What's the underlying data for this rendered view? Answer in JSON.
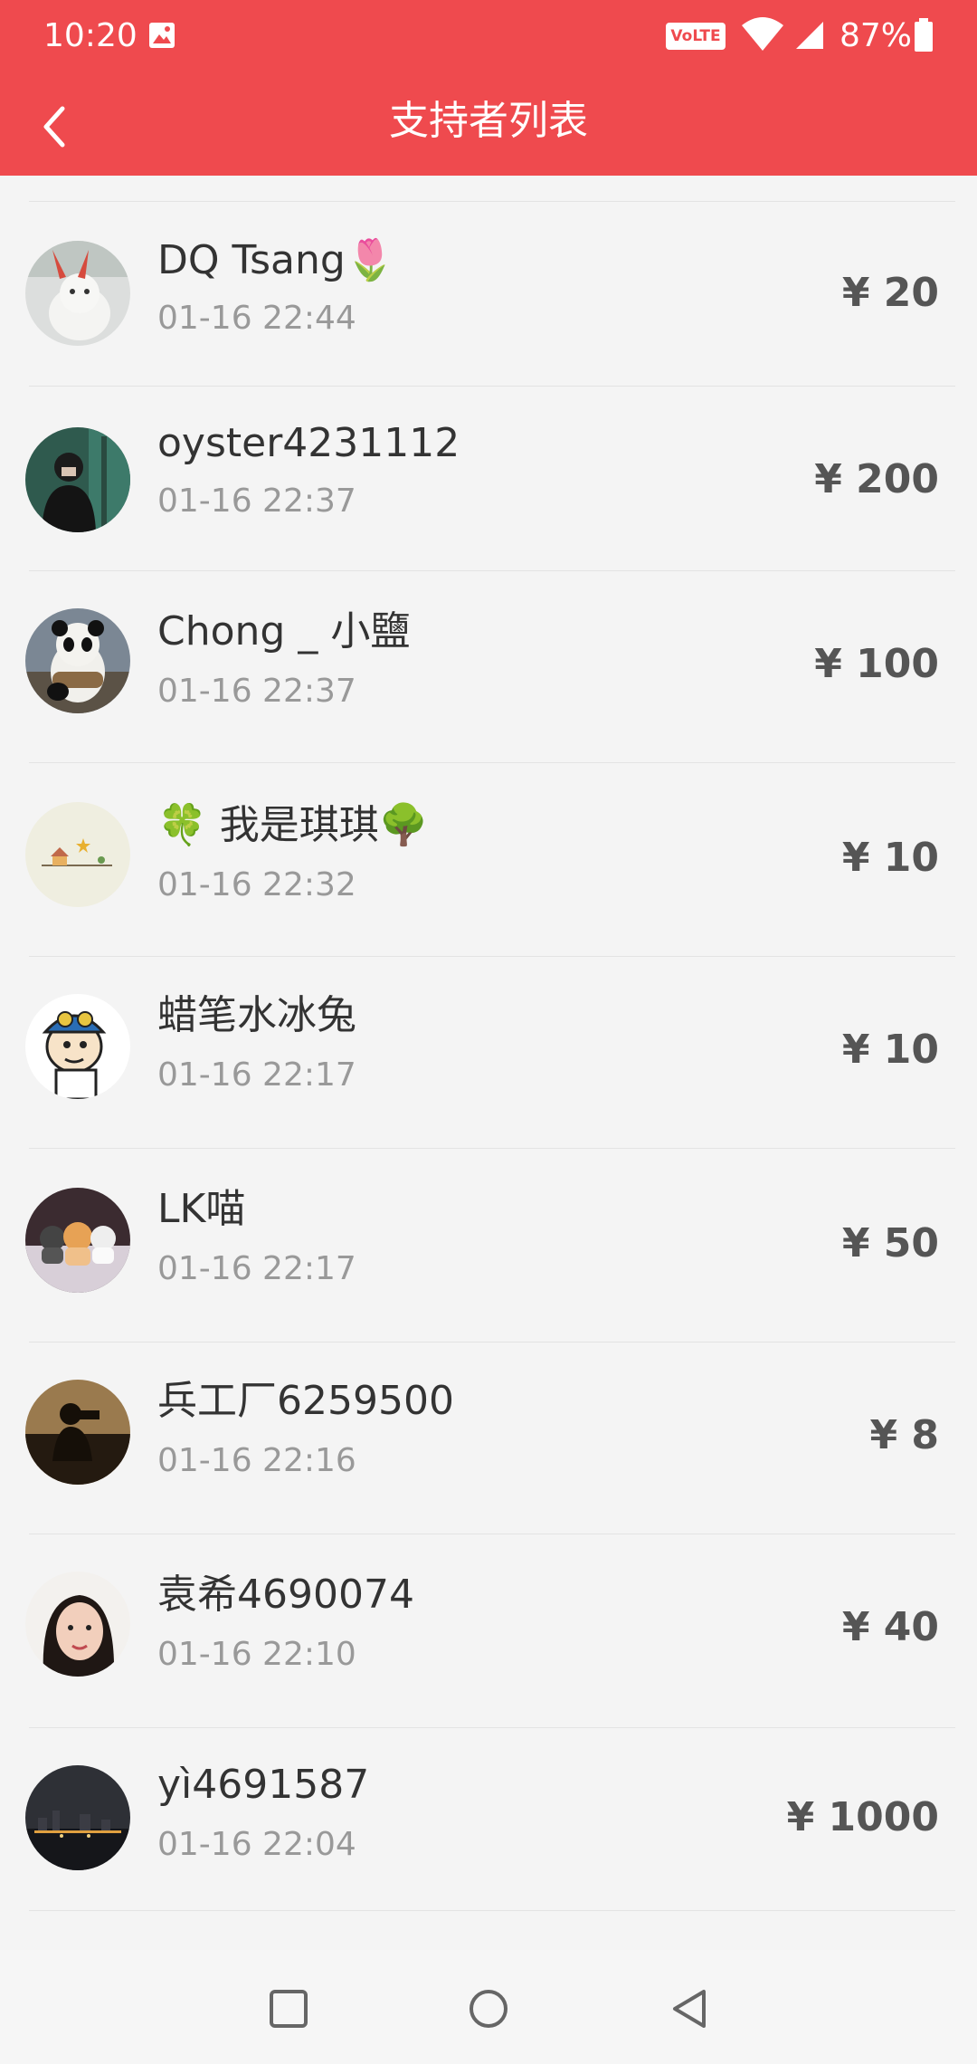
{
  "status": {
    "time": "10:20",
    "volte": "VoLTE",
    "battery": "87%"
  },
  "header": {
    "title": "支持者列表"
  },
  "supporters": [
    {
      "name": "DQ Tsang🌷",
      "time": "01-16 22:44",
      "amount": "¥ 20"
    },
    {
      "name": "oyster4231112",
      "time": "01-16 22:37",
      "amount": "¥ 200"
    },
    {
      "name": "Chong _ 小鹽",
      "time": "01-16 22:37",
      "amount": "¥ 100"
    },
    {
      "name": "🍀 我是琪琪🌳",
      "time": "01-16 22:32",
      "amount": "¥ 10"
    },
    {
      "name": "蜡笔水冰兔",
      "time": "01-16 22:17",
      "amount": "¥ 10"
    },
    {
      "name": "LK喵",
      "time": "01-16 22:17",
      "amount": "¥ 50"
    },
    {
      "name": "兵工厂6259500",
      "time": "01-16 22:16",
      "amount": "¥ 8"
    },
    {
      "name": "袁希4690074",
      "time": "01-16 22:10",
      "amount": "¥ 40"
    },
    {
      "name": "yì4691587",
      "time": "01-16 22:04",
      "amount": "¥ 1000"
    }
  ],
  "colors": {
    "header_bg": "#ef4a4e",
    "amount": "#555555",
    "secondary_text": "#999999"
  }
}
